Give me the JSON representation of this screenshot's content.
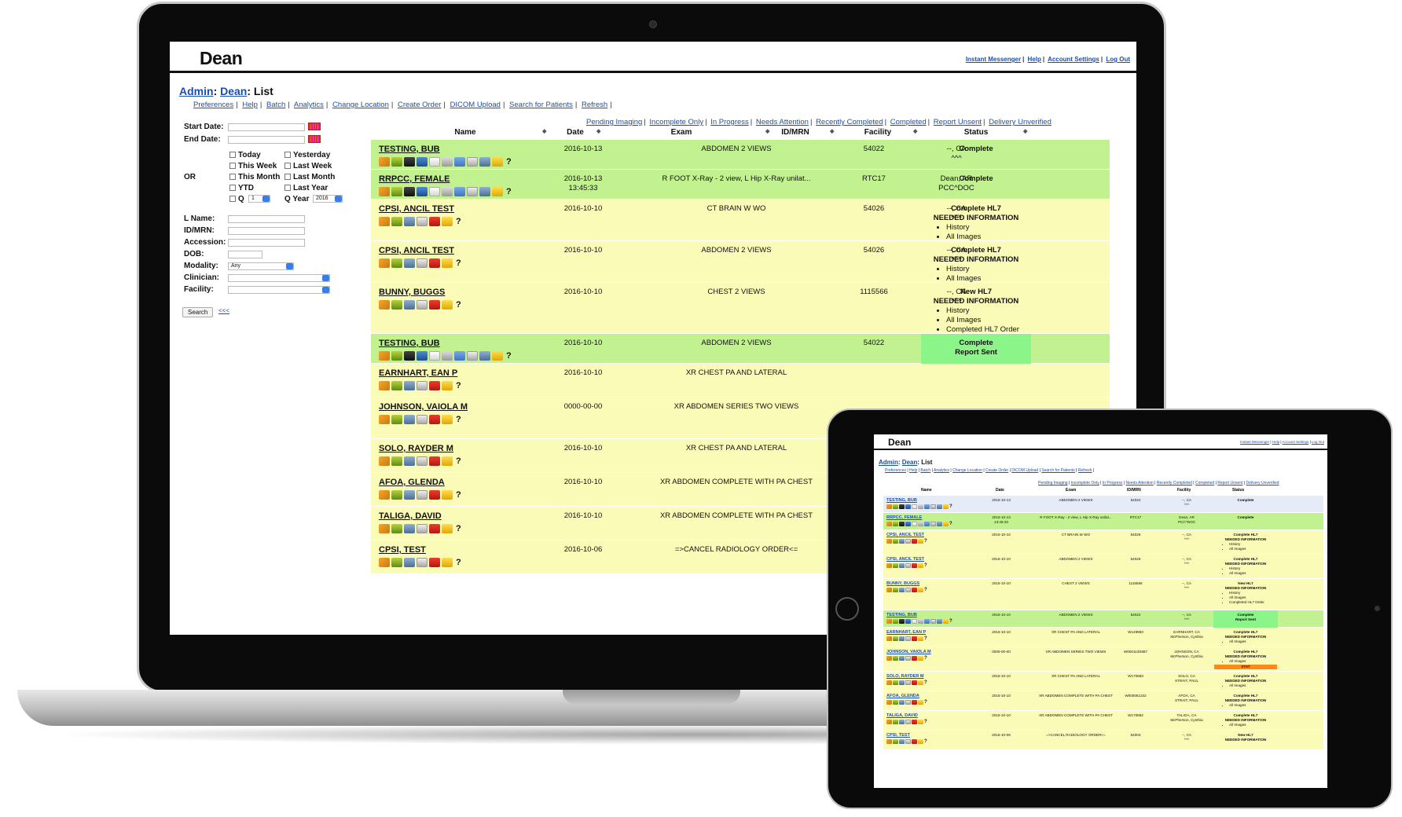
{
  "app": {
    "brand": "Dean",
    "top_links": [
      "Instant Messenger",
      "Help",
      "Account Settings",
      "Log Out"
    ],
    "breadcrumb": {
      "admin": "Admin",
      "colon1": ":",
      "dean": "Dean",
      "page": ": List"
    },
    "nav_links": [
      "Preferences",
      "Help",
      "Batch",
      "Analytics",
      "Change Location",
      "Create Order",
      "DICOM Upload",
      "Search for Patients",
      "Refresh"
    ]
  },
  "filters": {
    "start_date_label": "Start Date:",
    "end_date_label": "End Date:",
    "or_label": "OR",
    "checkboxes_left": [
      "Today",
      "This Week",
      "This Month",
      "YTD"
    ],
    "checkboxes_right": [
      "Yesterday",
      "Last Week",
      "Last Month",
      "Last Year"
    ],
    "q_label": "Q",
    "q_value": "1",
    "qyear_label": "Q Year",
    "qyear_value": "2016",
    "lname_label": "L Name:",
    "idmrn_label": "ID/MRN:",
    "accession_label": "Accession:",
    "dob_label": "DOB:",
    "modality_label": "Modality:",
    "modality_value": "Any",
    "clinician_label": "Clinician:",
    "facility_label": "Facility:",
    "search_button": "Search",
    "collapse_link": "<<<"
  },
  "status_filters": [
    "Pending Imaging",
    "Incomplete Only",
    "In Progress",
    "Needs Attention",
    "Recently Completed",
    "Completed",
    "Report Unsent",
    "Delivery Unverified"
  ],
  "columns": [
    "Name",
    "Date",
    "Exam",
    "ID/MRN",
    "Facility",
    "Status"
  ],
  "colors": {
    "green_row": "#c1f28f",
    "yellow_row": "#fbfbb8",
    "report_sent": "#8cf58a",
    "stat_badge": "#ff8a18",
    "link": "#1a4fb0"
  },
  "rows": [
    {
      "name": "TESTING, BUB",
      "date": "2016-10-13",
      "time": "",
      "exam": "ABDOMEN 2 VIEWS",
      "id": "54022",
      "facility": "--, CA",
      "facility2": "^^^",
      "status": "Complete",
      "status2": "",
      "items": [],
      "kind": "green",
      "icons": "full"
    },
    {
      "name": "RRPCC, FEMALE",
      "date": "2016-10-13",
      "time": "13:45:33",
      "exam": "R FOOT X-Ray - 2 view, L Hip X-Ray unilat...",
      "id": "RTC17",
      "facility": "Dean, AR",
      "facility2": "PCC^DOC",
      "status": "Complete",
      "status2": "",
      "items": [],
      "kind": "green",
      "icons": "full"
    },
    {
      "name": "CPSI, ANCIL TEST",
      "date": "2016-10-10",
      "time": "",
      "exam": "CT BRAIN W WO",
      "id": "54026",
      "facility": "--, CA",
      "facility2": "^^^",
      "status": "Complete HL7",
      "status2": "NEEDED INFORMATION",
      "items": [
        "History",
        "All Images"
      ],
      "kind": "yellow",
      "icons": "short"
    },
    {
      "name": "CPSI, ANCIL TEST",
      "date": "2016-10-10",
      "time": "",
      "exam": "ABDOMEN 2 VIEWS",
      "id": "54026",
      "facility": "--, CA",
      "facility2": "^^^",
      "status": "Complete HL7",
      "status2": "NEEDED INFORMATION",
      "items": [
        "History",
        "All Images"
      ],
      "kind": "yellow",
      "icons": "short"
    },
    {
      "name": "BUNNY, BUGGS",
      "date": "2016-10-10",
      "time": "",
      "exam": "CHEST 2 VIEWS",
      "id": "1115566",
      "facility": "--, CA",
      "facility2": "^^^",
      "status": "New HL7",
      "status2": "NEEDED INFORMATION",
      "items": [
        "History",
        "All Images",
        "Completed HL7 Order"
      ],
      "kind": "yellow",
      "icons": "short"
    },
    {
      "name": "TESTING, BUB",
      "date": "2016-10-10",
      "time": "",
      "exam": "ABDOMEN 2 VIEWS",
      "id": "54022",
      "facility": "--, CA",
      "facility2": "^^^",
      "status": "Complete",
      "status2": "Report Sent",
      "items": [],
      "kind": "green-sent",
      "icons": "full"
    },
    {
      "name": "EARNHART, EAN P",
      "date": "2016-10-10",
      "time": "",
      "exam": "XR CHEST PA AND LATERAL",
      "id": "",
      "facility": "",
      "facility2": "",
      "status": "",
      "status2": "",
      "items": [],
      "kind": "yellow",
      "icons": "short"
    },
    {
      "name": "JOHNSON, VAIOLA M",
      "date": "0000-00-00",
      "time": "",
      "exam": "XR ABDOMEN SERIES TWO VIEWS",
      "id": "",
      "facility": "",
      "facility2": "",
      "status": "",
      "status2": "",
      "items": [],
      "kind": "yellow",
      "icons": "short"
    },
    {
      "name": "SOLO, RAYDER M",
      "date": "2016-10-10",
      "time": "",
      "exam": "XR CHEST PA AND LATERAL",
      "id": "",
      "facility": "",
      "facility2": "",
      "status": "",
      "status2": "",
      "items": [],
      "kind": "yellow",
      "icons": "short"
    },
    {
      "name": "AFOA, GLENDA",
      "date": "2016-10-10",
      "time": "",
      "exam": "XR ABDOMEN COMPLETE WITH PA CHEST",
      "id": "",
      "facility": "",
      "facility2": "",
      "status": "",
      "status2": "",
      "items": [],
      "kind": "yellow",
      "icons": "short"
    },
    {
      "name": "TALIGA, DAVID",
      "date": "2016-10-10",
      "time": "",
      "exam": "XR ABDOMEN COMPLETE WITH PA CHEST",
      "id": "",
      "facility": "",
      "facility2": "",
      "status": "",
      "status2": "",
      "items": [],
      "kind": "yellow",
      "icons": "short"
    },
    {
      "name": "CPSI, TEST",
      "date": "2016-10-06",
      "time": "",
      "exam": "=>CANCEL RADIOLOGY ORDER<=",
      "id": "",
      "facility": "",
      "facility2": "",
      "status": "",
      "status2": "",
      "items": [],
      "kind": "yellow",
      "icons": "short"
    }
  ],
  "tablet_rows": [
    {
      "name": "TESTING, BUB",
      "date": "2016-10-13",
      "time": "",
      "exam": "ABDOMEN 2 VIEWS",
      "id": "54022",
      "facility": "--, CA",
      "facility2": "^^^",
      "status": "Complete",
      "status2": "",
      "items": [],
      "stat": "",
      "kind": "blue"
    },
    {
      "name": "RRPCC, FEMALE",
      "date": "2016-10-13",
      "time": "13:45:33",
      "exam": "R FOOT X-Ray - 2 view, L Hip X-Ray unilat...",
      "id": "RTC17",
      "facility": "Dean, AR",
      "facility2": "PCC^DOC",
      "status": "Complete",
      "status2": "",
      "items": [],
      "stat": "",
      "kind": "green"
    },
    {
      "name": "CPSI, ANCIL TEST",
      "date": "2016-10-10",
      "time": "",
      "exam": "CT BRAIN W WO",
      "id": "54026",
      "facility": "--, CA",
      "facility2": "^^^",
      "status": "Complete HL7",
      "status2": "NEEDED INFORMATION",
      "items": [
        "History",
        "All Images"
      ],
      "stat": "",
      "kind": "yellow"
    },
    {
      "name": "CPSI, ANCIL TEST",
      "date": "2016-10-10",
      "time": "",
      "exam": "ABDOMEN 2 VIEWS",
      "id": "54026",
      "facility": "--, CA",
      "facility2": "^^^",
      "status": "Complete HL7",
      "status2": "NEEDED INFORMATION",
      "items": [
        "History",
        "All Images"
      ],
      "stat": "",
      "kind": "yellow"
    },
    {
      "name": "BUNNY, BUGGS",
      "date": "2016-10-10",
      "time": "",
      "exam": "CHEST 2 VIEWS",
      "id": "1115566",
      "facility": "--, CA",
      "facility2": "^^^",
      "status": "New HL7",
      "status2": "NEEDED INFORMATION",
      "items": [
        "History",
        "All Images",
        "Completed HL7 Order"
      ],
      "stat": "",
      "kind": "yellow"
    },
    {
      "name": "TESTING, BUB",
      "date": "2016-10-10",
      "time": "",
      "exam": "ABDOMEN 2 VIEWS",
      "id": "54022",
      "facility": "--, CA",
      "facility2": "^^^",
      "status": "Complete",
      "status2": "Report Sent",
      "items": [],
      "stat": "",
      "kind": "green-sent"
    },
    {
      "name": "EARNHART, EAN P",
      "date": "2016-10-10",
      "time": "",
      "exam": "XR CHEST PA AND LATERAL",
      "id": "W149983",
      "facility": "EARNHART, CA",
      "facility2": "McPherson, Cynthia",
      "status": "Complete HL7",
      "status2": "NEEDED INFORMATION",
      "items": [
        "All Images"
      ],
      "stat": "",
      "kind": "yellow"
    },
    {
      "name": "JOHNSON, VAIOLA M",
      "date": "0000-00-00",
      "time": "",
      "exam": "XR ABDOMEN SERIES TWO VIEWS",
      "id": "W000113S887",
      "facility": "JOHNSON, CA",
      "facility2": "McPherson, Cynthia",
      "status": "Complete HL7",
      "status2": "NEEDED INFORMATION",
      "items": [
        "All Images"
      ],
      "stat": "STAT",
      "kind": "yellow"
    },
    {
      "name": "SOLO, RAYDER M",
      "date": "2016-10-10",
      "time": "",
      "exam": "XR CHEST PA AND LATERAL",
      "id": "W170863",
      "facility": "SOLO, CA",
      "facility2": "STRAIT, PAUL",
      "status": "Complete HL7",
      "status2": "NEEDED INFORMATION",
      "items": [
        "All Images"
      ],
      "stat": "",
      "kind": "yellow"
    },
    {
      "name": "AFOA, GLENDA",
      "date": "2016-10-10",
      "time": "",
      "exam": "XR ABDOMEN COMPLETE WITH PA CHEST",
      "id": "W000061232",
      "facility": "AFOA, CA",
      "facility2": "STRAIT, PAUL",
      "status": "Complete HL7",
      "status2": "NEEDED INFORMATION",
      "items": [
        "All Images"
      ],
      "stat": "",
      "kind": "yellow"
    },
    {
      "name": "TALIGA, DAVID",
      "date": "2016-10-10",
      "time": "",
      "exam": "XR ABDOMEN COMPLETE WITH PA CHEST",
      "id": "W170862",
      "facility": "TALIGA, CA",
      "facility2": "McPherson, Cynthia",
      "status": "Complete HL7",
      "status2": "NEEDED INFORMATION",
      "items": [
        "All Images"
      ],
      "stat": "",
      "kind": "yellow"
    },
    {
      "name": "CPSI, TEST",
      "date": "2016-10-06",
      "time": "",
      "exam": "=>CANCEL RADIOLOGY ORDER<=",
      "id": "54003",
      "facility": "--, CA",
      "facility2": "^^^",
      "status": "New HL7",
      "status2": "NEEDED INFORMATION",
      "items": [],
      "stat": "",
      "kind": "yellow"
    }
  ],
  "icon_names": {
    "full": [
      "pencil-icon",
      "move-icon",
      "binoculars-icon",
      "save-icon",
      "document-icon",
      "print-icon",
      "undo-icon",
      "gray-doc-icon",
      "group-icon",
      "folder-icon",
      "help-icon"
    ],
    "short": [
      "pencil-icon",
      "move-icon",
      "group-icon",
      "gray-doc-icon",
      "delete-icon",
      "folder-icon",
      "help-icon"
    ]
  }
}
